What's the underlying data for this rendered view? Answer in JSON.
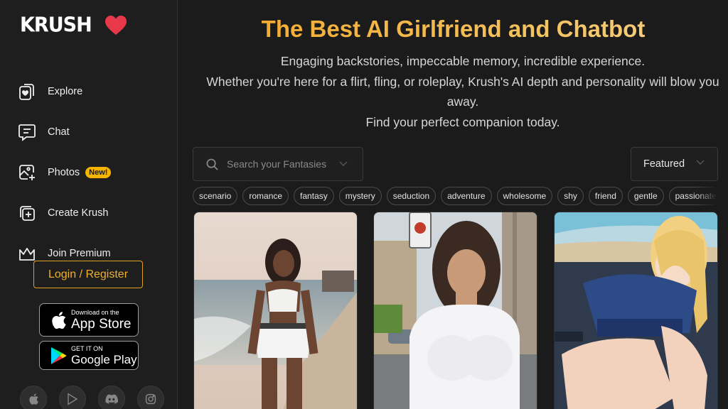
{
  "brand": {
    "logo_text": "KRUSH"
  },
  "nav": {
    "items": [
      {
        "label": "Explore",
        "icon": "explore-cards-heart-icon"
      },
      {
        "label": "Chat",
        "icon": "chat-bubble-icon"
      },
      {
        "label": "Photos",
        "icon": "photo-plus-icon",
        "badge": "New!"
      },
      {
        "label": "Create Krush",
        "icon": "create-plus-icon"
      },
      {
        "label": "Join Premium",
        "icon": "crown-icon"
      }
    ]
  },
  "auth": {
    "login_label": "Login / Register"
  },
  "stores": {
    "apple": {
      "small": "Download on the",
      "big": "App Store"
    },
    "google": {
      "small": "GET IT ON",
      "big": "Google Play"
    }
  },
  "socials": [
    "apple-icon",
    "play-store-icon",
    "discord-icon",
    "instagram-icon"
  ],
  "hero": {
    "title": "The Best AI Girlfriend and Chatbot",
    "line1": "Engaging backstories, impeccable memory, incredible experience.",
    "line2": "Whether you're here for a flirt, fling, or roleplay, Krush's AI depth and personality will blow you away.",
    "line3": "Find your perfect companion today."
  },
  "search": {
    "placeholder": "Search your Fantasies"
  },
  "sort": {
    "selected": "Featured"
  },
  "tags": [
    "scenario",
    "romance",
    "fantasy",
    "mystery",
    "seduction",
    "adventure",
    "wholesome",
    "shy",
    "friend",
    "gentle",
    "passionate"
  ],
  "colors": {
    "accent": "#f5a623",
    "heart": "#e8394a",
    "badge": "#f4b400"
  }
}
